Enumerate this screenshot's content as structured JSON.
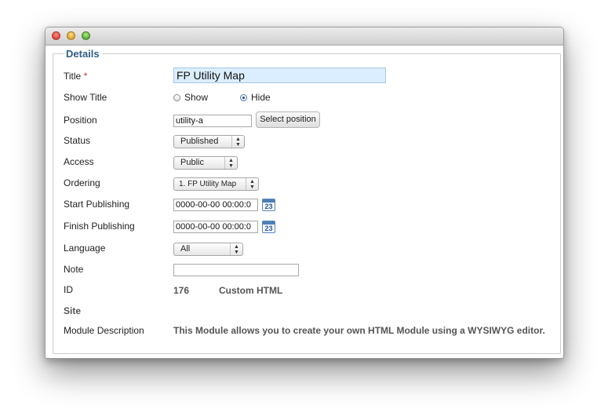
{
  "legend": "Details",
  "fields": {
    "title_label": "Title",
    "required_marker": "*",
    "title_value": "FP Utility Map",
    "show_title_label": "Show Title",
    "show_option": "Show",
    "hide_option": "Hide",
    "show_title_selected": "Hide",
    "position_label": "Position",
    "position_value": "utility-a",
    "select_position_button": "Select position",
    "status_label": "Status",
    "status_value": "Published",
    "access_label": "Access",
    "access_value": "Public",
    "ordering_label": "Ordering",
    "ordering_value": "1. FP Utility Map",
    "start_publishing_label": "Start Publishing",
    "start_publishing_value": "0000-00-00 00:00:0",
    "finish_publishing_label": "Finish Publishing",
    "finish_publishing_value": "0000-00-00 00:00:0",
    "calendar_day": "23",
    "language_label": "Language",
    "language_value": "All",
    "note_label": "Note",
    "note_value": "",
    "id_label": "ID",
    "id_value": "176",
    "module_type": "Custom HTML",
    "site_heading": "Site",
    "module_description_label": "Module Description",
    "module_description_value": "This Module allows you to create your own HTML Module using a WYSIWYG editor."
  },
  "colors": {
    "legend": "#2e5f87",
    "title_input_bg": "#dbeeff",
    "required": "#c0392b"
  },
  "icons": [
    "close-icon",
    "minimize-icon",
    "zoom-icon",
    "calendar-icon",
    "select-arrows-icon"
  ]
}
